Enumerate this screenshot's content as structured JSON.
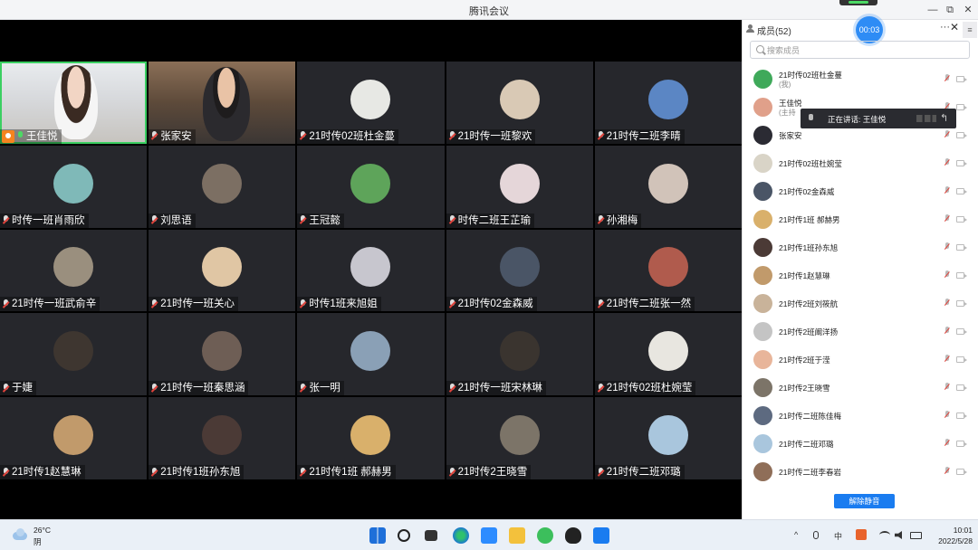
{
  "window": {
    "title": "腾讯会议",
    "minimize": "—",
    "maximize": "⧉",
    "close": "✕"
  },
  "grid": {
    "tiles": [
      {
        "name": "王佳悦",
        "type": "video1",
        "host": true,
        "mic_on": true
      },
      {
        "name": "张家安",
        "type": "video2"
      },
      {
        "name": "21时传02班杜金蔓",
        "color": "#e7e8e4"
      },
      {
        "name": "21时传一班黎欢",
        "color": "#d9c9b5"
      },
      {
        "name": "21时传二班李晴",
        "color": "#5b86c4"
      },
      {
        "name": "时传一班肖雨欣",
        "color": "#7fb9b8"
      },
      {
        "name": "刘思语",
        "color": "#7c6f63"
      },
      {
        "name": "王冠懿",
        "color": "#5ea45a"
      },
      {
        "name": "时传二班王芷瑜",
        "color": "#e5d6d9"
      },
      {
        "name": "孙湘梅",
        "color": "#d1c3b9"
      },
      {
        "name": "21时传一班武俞辛",
        "color": "#9a8f7e"
      },
      {
        "name": "21时传一班关心",
        "color": "#e0c6a4"
      },
      {
        "name": "时传1班来旭姐",
        "color": "#c7c6ce"
      },
      {
        "name": "21时传02金森威",
        "color": "#4a5566"
      },
      {
        "name": "21时传二班张一然",
        "color": "#b05b4d"
      },
      {
        "name": "于婕",
        "color": "#3e3630"
      },
      {
        "name": "21时传一班秦思涵",
        "color": "#6e5e55"
      },
      {
        "name": "张一明",
        "color": "#8aa0b6"
      },
      {
        "name": "21时传一班宋林琳",
        "color": "#3a342f"
      },
      {
        "name": "21时传02班杜婉莹",
        "color": "#e8e6e0"
      },
      {
        "name": "21时传1赵慧琳",
        "color": "#c19a6b"
      },
      {
        "name": "21时传1班孙东旭",
        "color": "#4b3a36"
      },
      {
        "name": "21时传1班 郝赫男",
        "color": "#d9b06b"
      },
      {
        "name": "21时传2王晓雪",
        "color": "#7c7468"
      },
      {
        "name": "21时传二班邓璐",
        "color": "#a9c6dd"
      }
    ]
  },
  "panel": {
    "title": "成员(52)",
    "timer": "00:03",
    "more": "···",
    "close": "✕",
    "side_button": "≡",
    "search_placeholder": "搜索成员",
    "members": [
      {
        "name": "21时传02班杜金蔓",
        "sub": "(我)",
        "color": "#3fa95a"
      },
      {
        "name": "王佳悦",
        "sub": "(主持",
        "color": "#e0a08a"
      },
      {
        "name": "张家安",
        "color": "#2b2b33"
      },
      {
        "name": "21时传02班杜婉莹",
        "color": "#d9d4c7"
      },
      {
        "name": "21时传02金森威",
        "color": "#4a5566"
      },
      {
        "name": "21时传1班 郝赫男",
        "color": "#d9b06b"
      },
      {
        "name": "21时传1班孙东旭",
        "color": "#4b3a36"
      },
      {
        "name": "21时传1赵慧琳",
        "color": "#c19a6b"
      },
      {
        "name": "21时传2班刘筱航",
        "color": "#c9b39a"
      },
      {
        "name": "21时传2班阚洋扬",
        "color": "#c4c4c4"
      },
      {
        "name": "21时传2班于滢",
        "color": "#e8b59a"
      },
      {
        "name": "21时传2王晓雪",
        "color": "#7c7468"
      },
      {
        "name": "21时传二班陈佳梅",
        "color": "#5d6a80"
      },
      {
        "name": "21时传二班邓璐",
        "color": "#a9c6dd"
      },
      {
        "name": "21时传二班李春岩",
        "color": "#8f6e58"
      }
    ],
    "tooltip": "正在讲话: 王佳悦",
    "tooltip_arrow": "↰",
    "unmute_button": "解除静音"
  },
  "taskbar": {
    "temperature": "26°C",
    "condition": "阴",
    "tray_arrow": "^",
    "tray_lang": "中",
    "time": "10:01",
    "date": "2022/5/28"
  }
}
